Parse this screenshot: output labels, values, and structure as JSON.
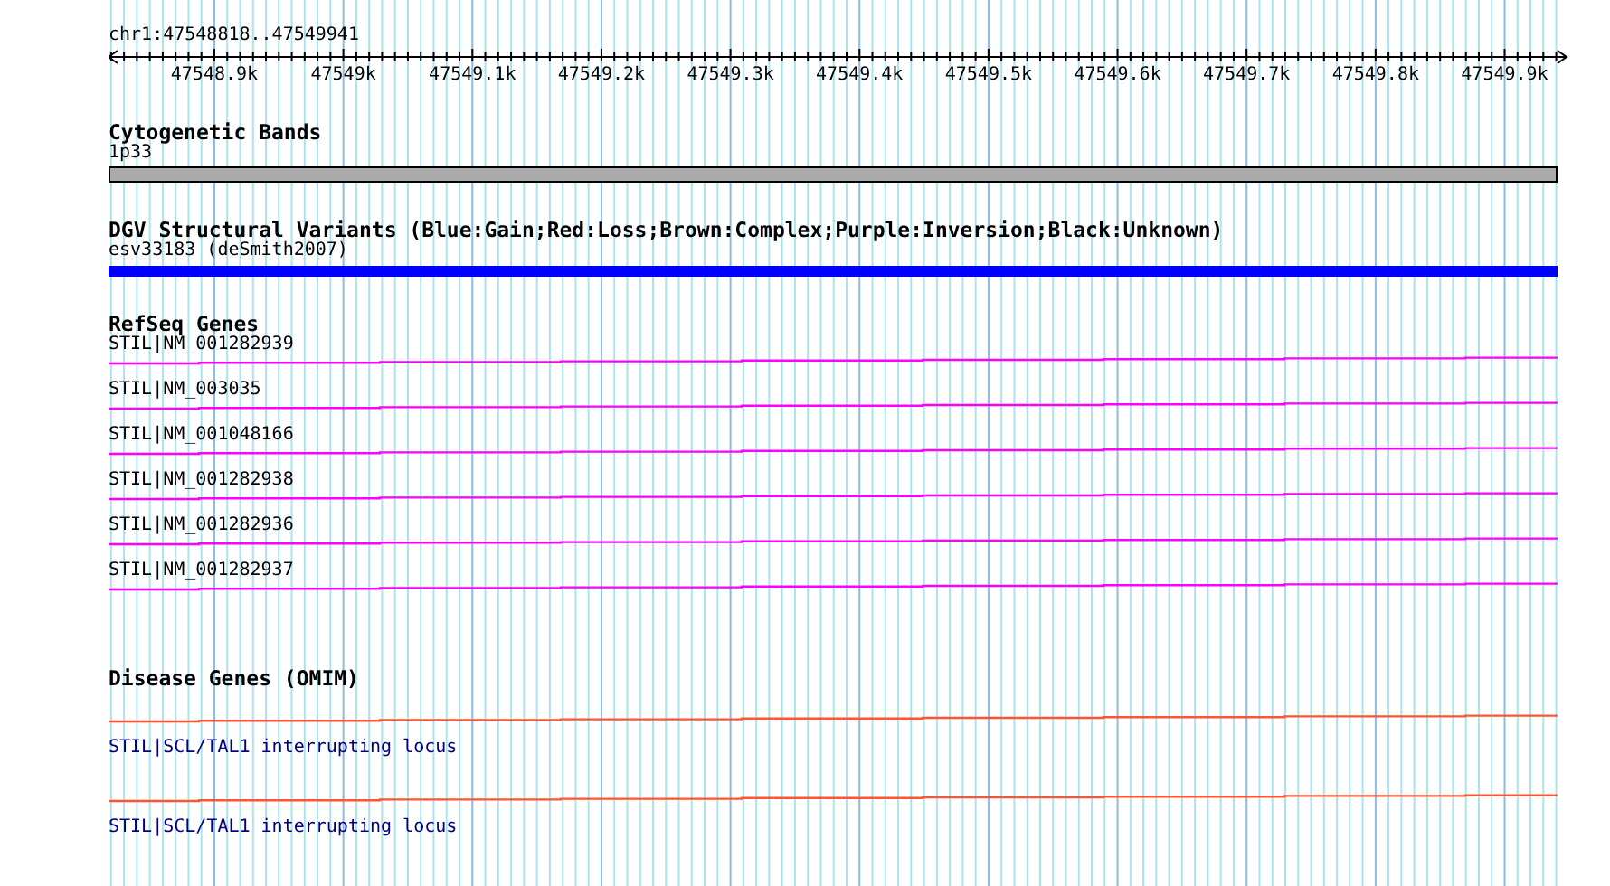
{
  "ruler": {
    "range": "chr1:47548818..47549941",
    "ticks": [
      "47548.9k",
      "47549k",
      "47549.1k",
      "47549.2k",
      "47549.3k",
      "47549.4k",
      "47549.5k",
      "47549.6k",
      "47549.7k",
      "47549.8k",
      "47549.9k"
    ]
  },
  "tracks": [
    {
      "kind": "band",
      "title": "Cytogenetic Bands",
      "features": [
        {
          "label": "1p33"
        }
      ]
    },
    {
      "kind": "variant",
      "title": "DGV Structural Variants (Blue:Gain;Red:Loss;Brown:Complex;Purple:Inversion;Black:Unknown)",
      "features": [
        {
          "label": "esv33183 (deSmith2007)",
          "color": "#0000ff"
        }
      ]
    },
    {
      "kind": "gene",
      "title": "RefSeq Genes",
      "features": [
        {
          "label": "STIL|NM_001282939"
        },
        {
          "label": "STIL|NM_003035"
        },
        {
          "label": "STIL|NM_001048166"
        },
        {
          "label": "STIL|NM_001282938"
        },
        {
          "label": "STIL|NM_001282936"
        },
        {
          "label": "STIL|NM_001282937"
        }
      ]
    },
    {
      "kind": "disease",
      "title": "Disease Genes (OMIM)",
      "features": [
        {
          "label": "STIL|SCL/TAL1 interrupting locus"
        },
        {
          "label": "STIL|SCL/TAL1 interrupting locus"
        }
      ]
    }
  ]
}
